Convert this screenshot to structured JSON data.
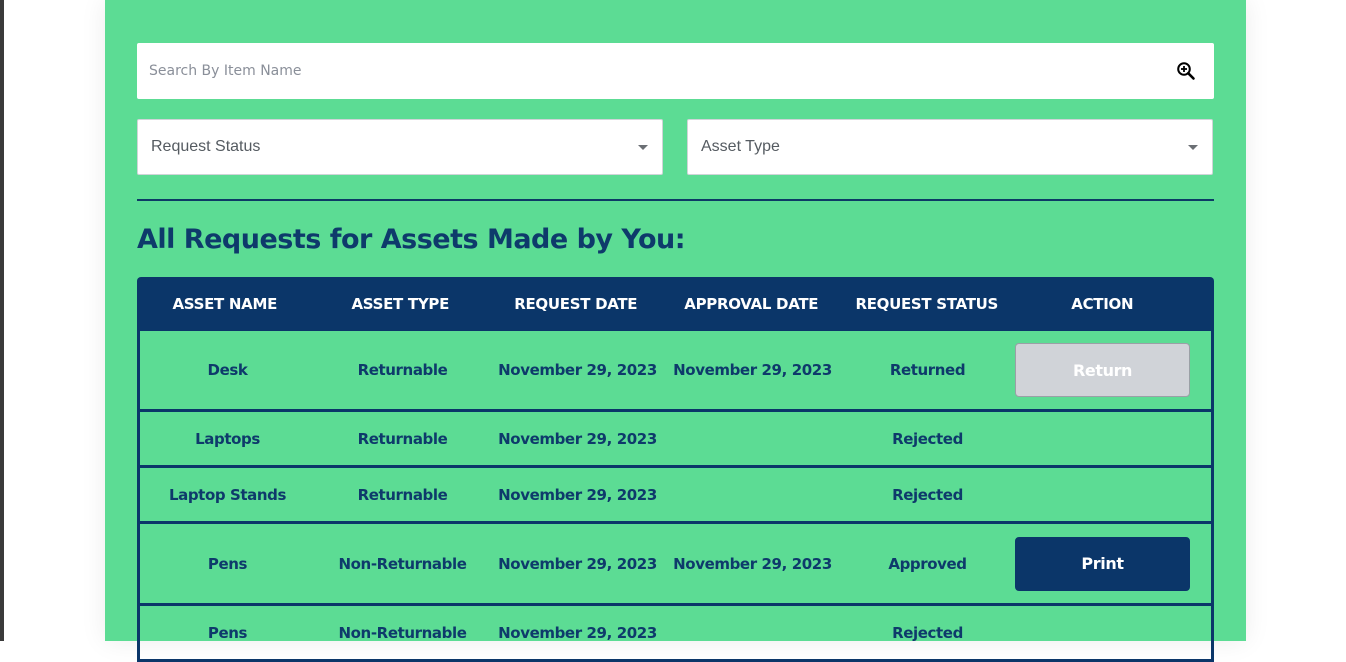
{
  "search": {
    "placeholder": "Search By Item Name"
  },
  "filters": {
    "request_status_label": "Request Status",
    "asset_type_label": "Asset Type"
  },
  "section": {
    "title": "All Requests for Assets Made by You:"
  },
  "table": {
    "headers": [
      "ASSET NAME",
      "ASSET TYPE",
      "REQUEST DATE",
      "APPROVAL DATE",
      "REQUEST STATUS",
      "ACTION"
    ],
    "rows": [
      {
        "asset_name": "Desk",
        "asset_type": "Returnable",
        "request_date": "November 29, 2023",
        "approval_date": "November 29, 2023",
        "status": "Returned",
        "action": "Return"
      },
      {
        "asset_name": "Laptops",
        "asset_type": "Returnable",
        "request_date": "November 29, 2023",
        "approval_date": "",
        "status": "Rejected",
        "action": ""
      },
      {
        "asset_name": "Laptop Stands",
        "asset_type": "Returnable",
        "request_date": "November 29, 2023",
        "approval_date": "",
        "status": "Rejected",
        "action": ""
      },
      {
        "asset_name": "Pens",
        "asset_type": "Non-Returnable",
        "request_date": "November 29, 2023",
        "approval_date": "November 29, 2023",
        "status": "Approved",
        "action": "Print"
      },
      {
        "asset_name": "Pens",
        "asset_type": "Non-Returnable",
        "request_date": "November 29, 2023",
        "approval_date": "",
        "status": "Rejected",
        "action": ""
      }
    ]
  },
  "colors": {
    "panel_bg": "#5cdc94",
    "navy": "#0b3669",
    "disabled_button": "#d0d3d8"
  },
  "icons": {
    "search": "zoom-in-magnifier-icon",
    "dropdown": "caret-down-icon"
  }
}
